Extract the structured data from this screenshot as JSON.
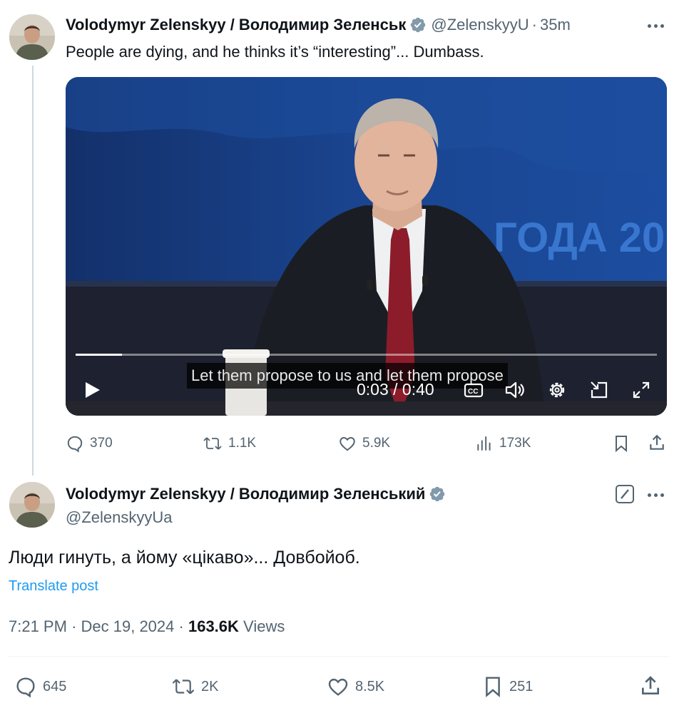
{
  "tweet1": {
    "author_name": "Volodymyr Zelenskyy / Володимир Зеленськ",
    "handle": "@ZelenskyyU",
    "separator": "·",
    "time_ago": "35m",
    "text": "People are dying, and he thinks it’s “interesting”... Dumbass.",
    "video": {
      "subtitle": "Let them propose to us and let them propose",
      "backdrop_text": "ГОДА 20",
      "timecode": "0:03 / 0:40",
      "progress": 0.08
    },
    "actions": {
      "replies": "370",
      "reposts": "1.1K",
      "likes": "5.9K",
      "views": "173K"
    }
  },
  "tweet2": {
    "author_name": "Volodymyr Zelenskyy / Володимир Зеленський",
    "handle": "@ZelenskyyUa",
    "text": "Люди гинуть, а йому «цікаво»... Довбойоб.",
    "translate_label": "Translate post",
    "time": "7:21 PM",
    "date": "Dec 19, 2024",
    "separator": "·",
    "views_count": "163.6K",
    "views_label": "Views",
    "actions": {
      "replies": "645",
      "reposts": "2K",
      "likes": "8.5K",
      "bookmarks": "251"
    }
  },
  "colors": {
    "text_primary": "#0f1419",
    "text_secondary": "#536471",
    "link": "#1d9bf0",
    "verified_badge": "#829aab",
    "divider": "#eff3f4"
  },
  "icons": [
    "verified-icon",
    "more-icon",
    "play-icon",
    "captions-icon",
    "volume-icon",
    "settings-icon",
    "pip-icon",
    "fullscreen-icon",
    "reply-icon",
    "repost-icon",
    "like-icon",
    "views-icon",
    "bookmark-icon",
    "share-icon",
    "edit-icon"
  ]
}
